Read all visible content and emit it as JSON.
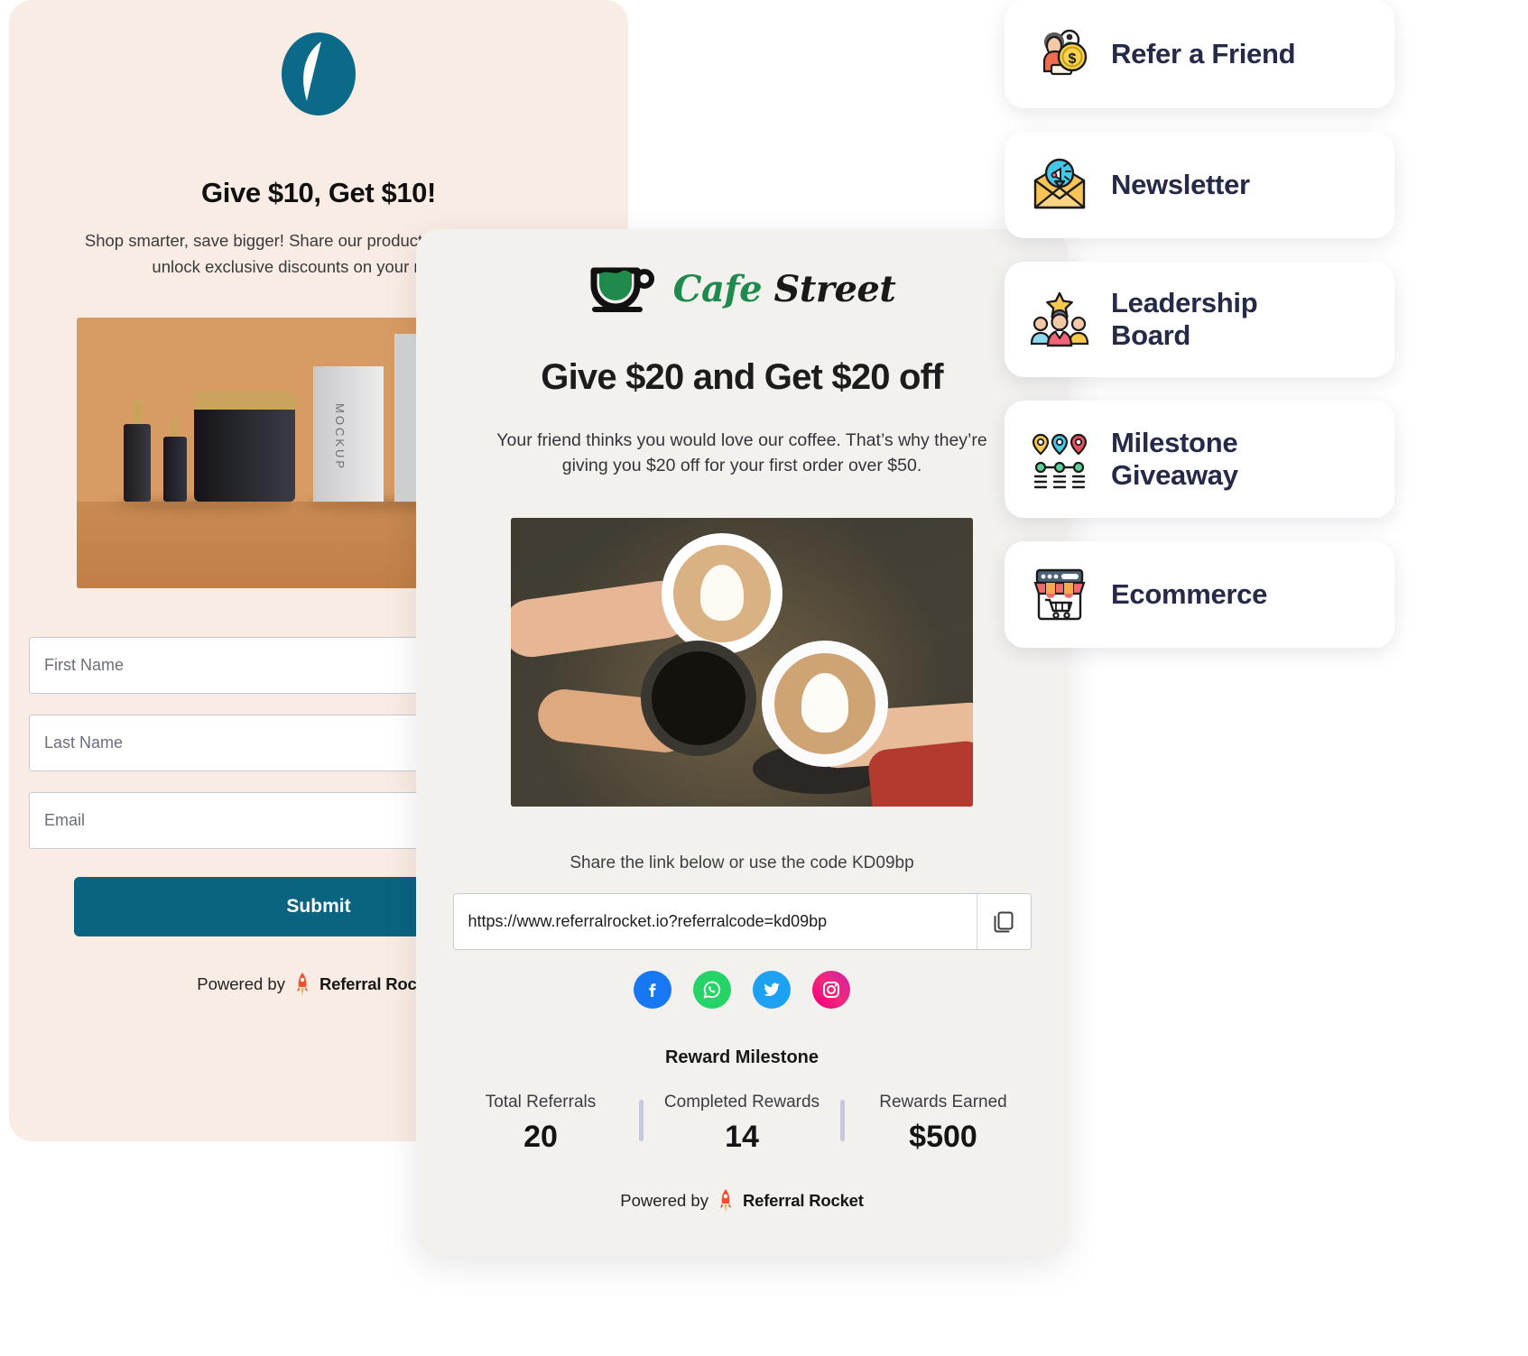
{
  "left_card": {
    "logo_icon": "leaf-circle-logo",
    "title": "Give $10, Get $10!",
    "subtitle": "Shop smarter, save bigger! Share our products with friends and\nunlock exclusive discounts on your next onlin",
    "hero_image_alt": "cosmetic-products-photo",
    "fields": [
      {
        "name": "first-name",
        "placeholder": "First Name",
        "value": ""
      },
      {
        "name": "last-name",
        "placeholder": "Last Name",
        "value": ""
      },
      {
        "name": "email",
        "placeholder": "Email",
        "value": ""
      }
    ],
    "submit_label": "Submit",
    "powered_by": {
      "prefix": "Powered by",
      "brand": "Referral Rocket",
      "icon": "rocket-icon"
    },
    "accent_color": "#0a6480",
    "background_color": "#f8ece4"
  },
  "center_card": {
    "brand": {
      "word_1": "Cafe",
      "word_2": "Street",
      "icon": "coffee-cup-icon",
      "color_1": "#1f8a4c",
      "color_2": "#191919"
    },
    "title": "Give $20 and Get $20 off",
    "subtitle": "Your friend thinks you would love our coffee. That’s why they’re\ngiving you $20 off for your first order over $50.",
    "hero_image_alt": "hands-toasting-coffee-cups-photo",
    "share_label": "Share the link below or use the code KD09bp",
    "referral_code": "KD09bp",
    "referral_link": "https://www.referralrocket.io?referralcode=kd09bp",
    "copy_icon": "copy-icon",
    "socials": [
      {
        "name": "facebook",
        "color": "#1877F2"
      },
      {
        "name": "whatsapp",
        "color": "#25D366"
      },
      {
        "name": "twitter",
        "color": "#1DA1F2"
      },
      {
        "name": "instagram",
        "color": "#D6249F"
      }
    ],
    "milestone_title": "Reward Milestone",
    "stats": [
      {
        "label": "Total Referrals",
        "value": "20"
      },
      {
        "label": "Completed Rewards",
        "value": "14"
      },
      {
        "label": "Rewards Earned",
        "value": "$500"
      }
    ],
    "powered_by": {
      "prefix": "Powered by",
      "brand": "Referral Rocket",
      "icon": "rocket-icon"
    },
    "background_color": "#f2f1ee"
  },
  "feature_pills": [
    {
      "label": "Refer a Friend",
      "icon": "refer-a-friend-icon"
    },
    {
      "label": "Newsletter",
      "icon": "newsletter-envelope-icon"
    },
    {
      "label": "Leadership\nBoard",
      "icon": "leadership-board-icon"
    },
    {
      "label": "Milestone\nGiveaway",
      "icon": "milestone-giveaway-icon"
    },
    {
      "label": "Ecommerce",
      "icon": "ecommerce-store-icon"
    }
  ]
}
